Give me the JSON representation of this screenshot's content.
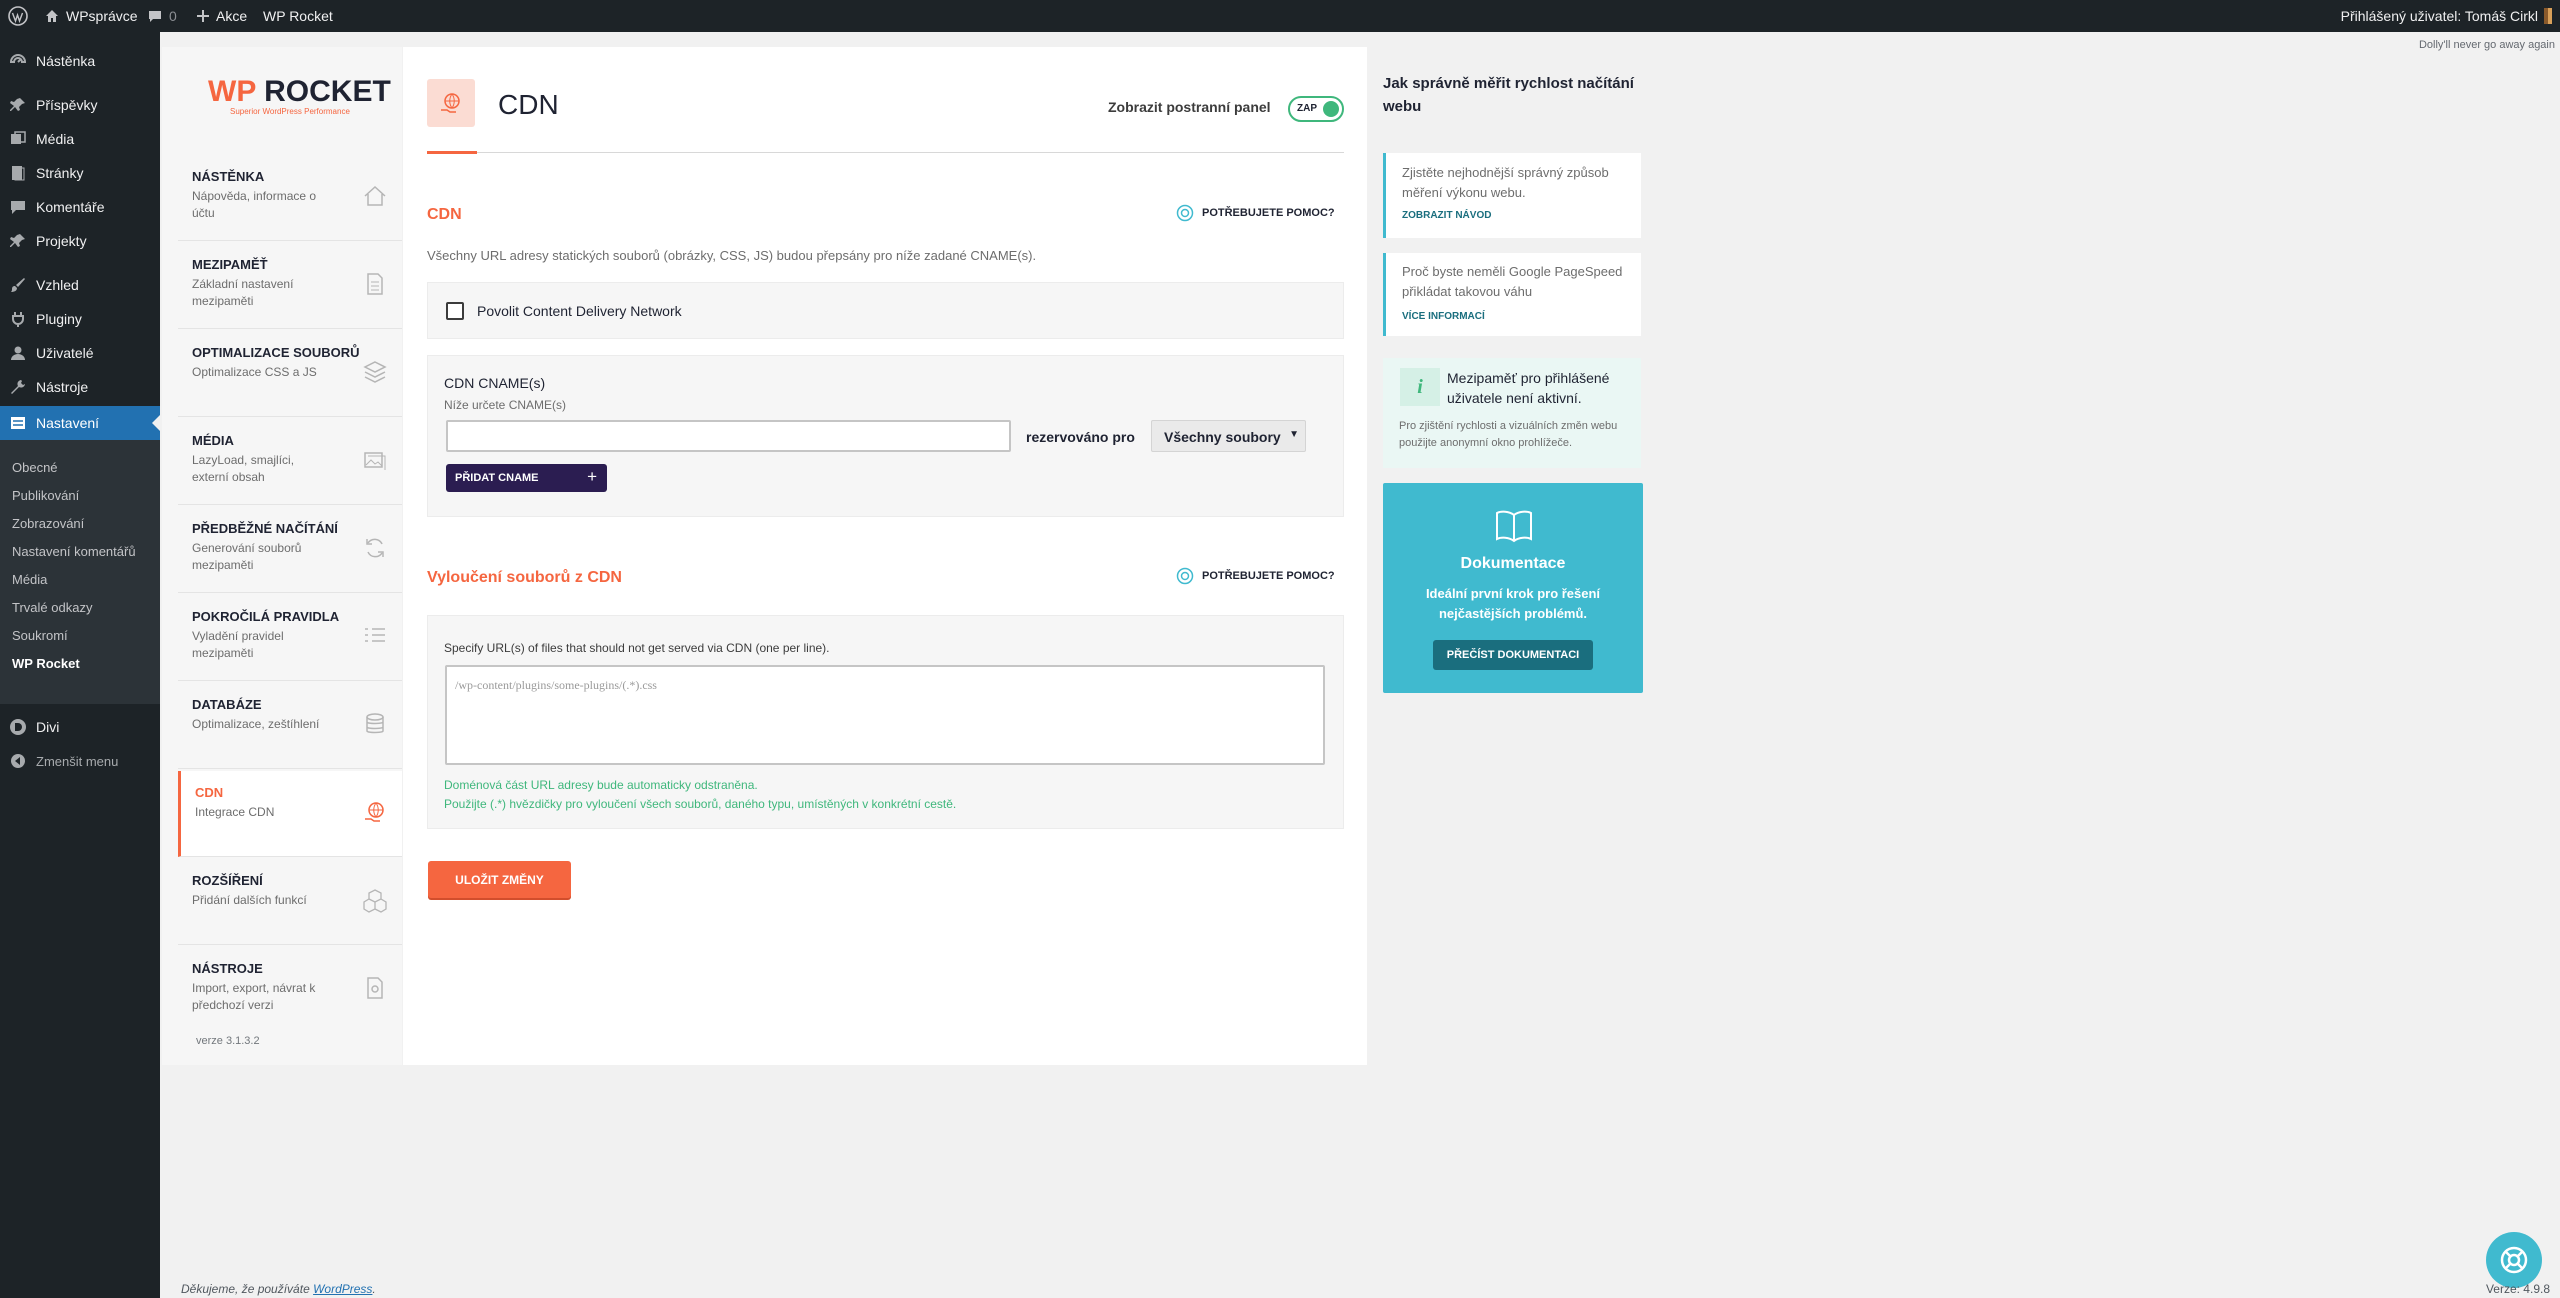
{
  "adminbar": {
    "site_name": "WPsprávce",
    "comments_count": "0",
    "new_label": "Akce",
    "plugin_label": "WP Rocket",
    "user_greeting": "Přihlášený uživatel: Tomáš Cirkl"
  },
  "menu": {
    "items": [
      {
        "label": "Nástěnka",
        "icon": "dashboard-icon"
      },
      {
        "label": "Příspěvky",
        "icon": "pin-icon"
      },
      {
        "label": "Média",
        "icon": "media-icon"
      },
      {
        "label": "Stránky",
        "icon": "page-icon"
      },
      {
        "label": "Komentáře",
        "icon": "comment-icon"
      },
      {
        "label": "Projekty",
        "icon": "pin-icon"
      },
      {
        "label": "Vzhled",
        "icon": "brush-icon"
      },
      {
        "label": "Pluginy",
        "icon": "plugin-icon"
      },
      {
        "label": "Uživatelé",
        "icon": "user-icon"
      },
      {
        "label": "Nástroje",
        "icon": "wrench-icon"
      },
      {
        "label": "Nastavení",
        "icon": "settings-icon"
      }
    ],
    "submenu": [
      "Obecné",
      "Publikování",
      "Zobrazování",
      "Nastavení komentářů",
      "Média",
      "Trvalé odkazy",
      "Soukromí",
      "WP Rocket"
    ],
    "divi": "Divi",
    "collapse": "Zmenšit menu"
  },
  "dolly": "Dolly'll never go away again",
  "wpr": {
    "logo_text": "WP ROCKET",
    "logo_tagline": "Superior WordPress Performance",
    "version": "verze 3.1.3.2",
    "nav": [
      {
        "title": "NÁSTĚNKA",
        "desc": "Nápověda, informace o účtu"
      },
      {
        "title": "MEZIPAMĚŤ",
        "desc": "Základní nastavení mezipaměti"
      },
      {
        "title": "OPTIMALIZACE SOUBORŮ",
        "desc": "Optimalizace CSS a JS"
      },
      {
        "title": "MÉDIA",
        "desc": "LazyLoad, smajlíci, externí obsah"
      },
      {
        "title": "PŘEDBĚŽNÉ NAČÍTÁNÍ",
        "desc": "Generování souborů mezipaměti"
      },
      {
        "title": "POKROČILÁ PRAVIDLA",
        "desc": "Vyladění pravidel mezipaměti"
      },
      {
        "title": "DATABÁZE",
        "desc": "Optimalizace, zeštíhlení"
      },
      {
        "title": "CDN",
        "desc": "Integrace CDN"
      },
      {
        "title": "ROZŠÍŘENÍ",
        "desc": "Přidání dalších funkcí"
      },
      {
        "title": "NÁSTROJE",
        "desc": "Import, export, návrat k předchozí verzi"
      }
    ]
  },
  "page": {
    "title": "CDN",
    "sidebar_toggle_label": "Zobrazit postranní panel",
    "toggle_state": "ZAP",
    "section1": {
      "title": "CDN",
      "help": "POTŘEBUJETE POMOC?",
      "description": "Všechny URL adresy statických souborů (obrázky, CSS, JS) budou přepsány pro níže zadané CNAME(s).",
      "enable_label": "Povolit Content Delivery Network"
    },
    "cname": {
      "title": "CDN CNAME(s)",
      "subtitle": "Níže určete CNAME(s)",
      "reserved_label": "rezervováno pro",
      "select_value": "Všechny soubory",
      "add_button": "PŘIDAT CNAME"
    },
    "section2": {
      "title": "Vyloučení souborů z CDN",
      "help": "POTŘEBUJETE POMOC?",
      "description": "Specify URL(s) of files that should not get served via CDN (one per line).",
      "placeholder": "/wp-content/plugins/some-plugins/(.*).css",
      "note1": "Doménová část URL adresy bude automaticky odstraněna.",
      "note2": "Použijte (.*) hvězdičky pro vyloučení všech souborů, daného typu, umístěných v konkrétní cestě."
    },
    "save_button": "ULOŽIT ZMĚNY"
  },
  "side": {
    "heading": "Jak správně měřit rychlost načítání webu",
    "card1_text": "Zjistěte nejhodnější správný způsob měření výkonu webu.",
    "card1_link": "ZOBRAZIT NÁVOD",
    "card2_text": "Proč byste neměli Google PageSpeed přikládat takovou váhu",
    "card2_link": "VÍCE INFORMACÍ",
    "info_title": "Mezipaměť pro přihlášené uživatele není aktivní.",
    "info_text": "Pro zjištění rychlosti a vizuálních změn webu použijte anonymní okno prohlížeče.",
    "doc_title": "Dokumentace",
    "doc_text": "Ideální první krok pro řešení nejčastějších problémů.",
    "doc_button": "PŘEČÍST DOKUMENTACI"
  },
  "footer": {
    "thanks_prefix": "Děkujeme, že používáte ",
    "thanks_link": "WordPress",
    "thanks_suffix": ".",
    "version": "Verze: 4.9.8"
  },
  "colors": {
    "accent": "#f56640",
    "dark": "#2b1d51",
    "teal": "#40bacf",
    "wp_blue": "#2271b1"
  }
}
